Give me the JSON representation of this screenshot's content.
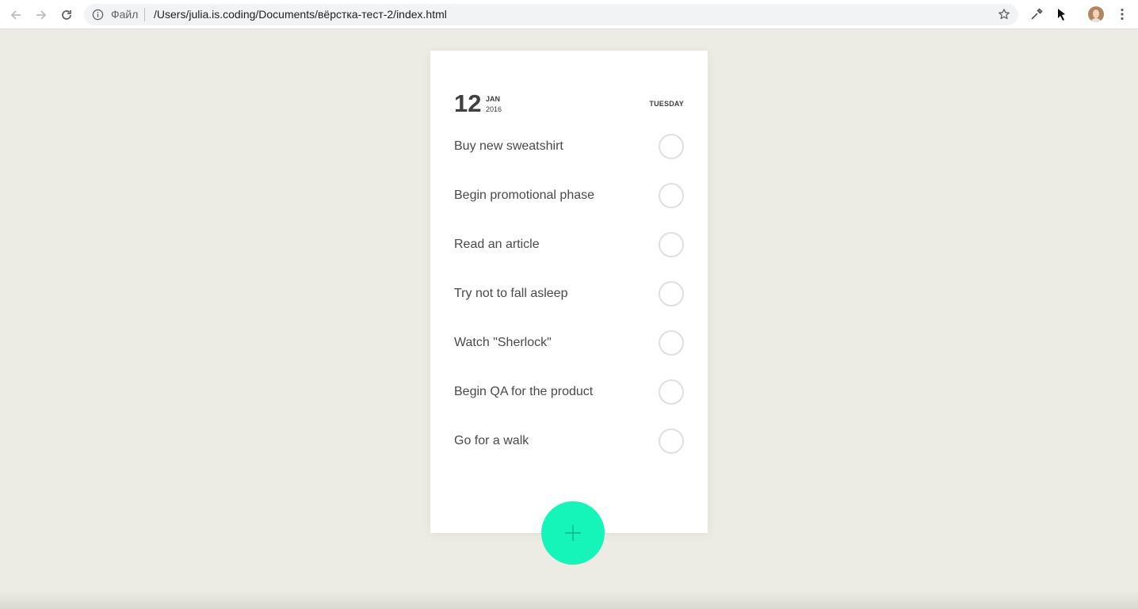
{
  "browser": {
    "scheme_label": "Файл",
    "url": "/Users/julia.is.coding/Documents/вёрстка-тест-2/index.html"
  },
  "date": {
    "day": "12",
    "month": "JAN",
    "year": "2016",
    "weekday": "TUESDAY"
  },
  "tasks": [
    {
      "label": "Buy new sweatshirt",
      "done": false
    },
    {
      "label": "Begin promotional phase",
      "done": false
    },
    {
      "label": "Read an article",
      "done": false
    },
    {
      "label": "Try not to fall asleep",
      "done": false
    },
    {
      "label": "Watch \"Sherlock\"",
      "done": false
    },
    {
      "label": "Begin QA for the product",
      "done": false
    },
    {
      "label": "Go for a walk",
      "done": false
    }
  ],
  "colors": {
    "background": "#ecece4",
    "accent": "#16f5b9",
    "text": "#404040",
    "check_border": "#e0e0e0"
  },
  "icons": {
    "add": "plus-icon"
  }
}
